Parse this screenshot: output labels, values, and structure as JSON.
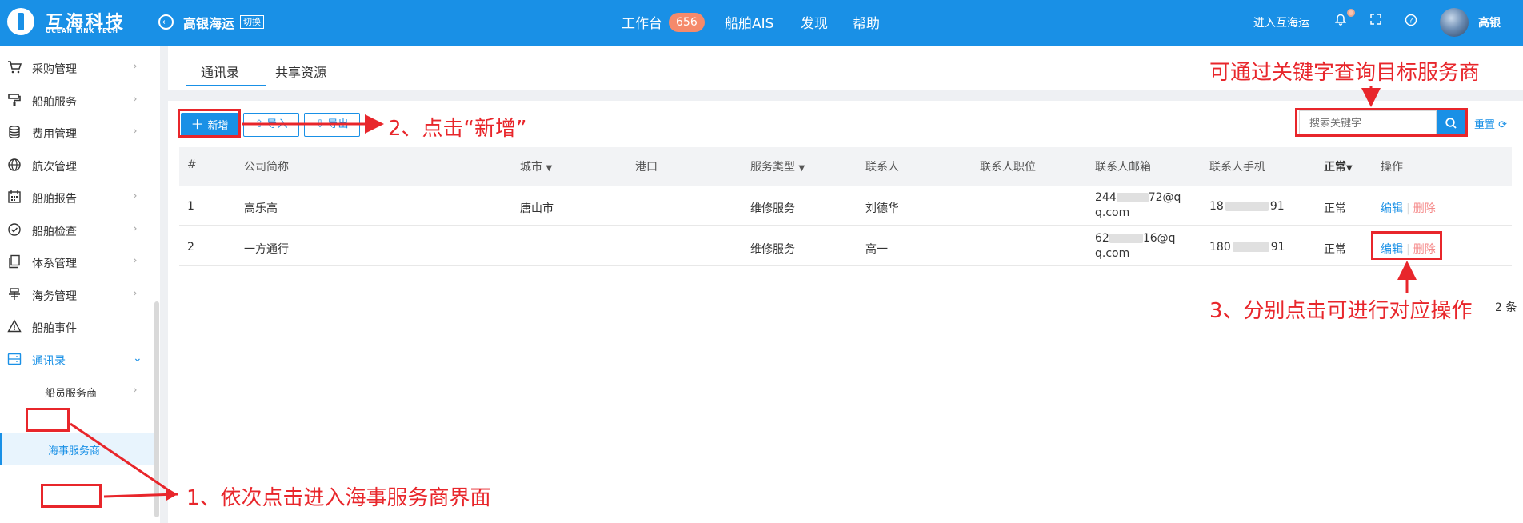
{
  "topbar": {
    "logo_cn": "互海科技",
    "logo_en": "OCEAN LINK TECH",
    "company": "高银海运",
    "switch_label": "切换",
    "nav": [
      {
        "label": "工作台"
      },
      {
        "label": "船舶AIS"
      },
      {
        "label": "发现"
      },
      {
        "label": "帮助"
      }
    ],
    "badge": "656",
    "enter_label": "进入互海运",
    "user_name": "高银",
    "icons": [
      "bell-icon",
      "fullscreen-icon",
      "help-icon"
    ]
  },
  "sidebar": {
    "items": [
      {
        "label": "采购管理",
        "icon": "cart-icon"
      },
      {
        "label": "船舶服务",
        "icon": "paint-roller-icon"
      },
      {
        "label": "费用管理",
        "icon": "coins-icon"
      },
      {
        "label": "航次管理",
        "icon": "globe-icon"
      },
      {
        "label": "船舶报告",
        "icon": "calendar-icon"
      },
      {
        "label": "船舶检查",
        "icon": "check-circle-icon"
      },
      {
        "label": "体系管理",
        "icon": "documents-icon"
      },
      {
        "label": "海务管理",
        "icon": "anchor-icon"
      },
      {
        "label": "船舶事件",
        "icon": "warning-icon"
      },
      {
        "label": "通讯录",
        "icon": "contacts-icon"
      }
    ],
    "sub_items": [
      {
        "label": "船员服务商"
      },
      {
        "label": "海事服务商"
      }
    ]
  },
  "tabs": [
    {
      "label": "通讯录"
    },
    {
      "label": "共享资源"
    }
  ],
  "toolbar": {
    "add_label": "新增",
    "import_label": "导入",
    "export_label": "导出",
    "search_placeholder": "搜索关键字",
    "reset_label": "重置"
  },
  "table": {
    "columns": [
      "#",
      "公司简称",
      "城市",
      "港口",
      "服务类型",
      "联系人",
      "联系人职位",
      "联系人邮箱",
      "联系人手机",
      "正常",
      "操作"
    ],
    "rows": [
      {
        "index": "1",
        "company": "高乐高",
        "city": "唐山市",
        "port": "",
        "service": "维修服务",
        "contact": "刘德华",
        "position": "",
        "email_a": "244",
        "email_b": "72@qq.co",
        "email_c": "m",
        "phone_a": "18",
        "phone_b": "91",
        "status": "正常",
        "edit": "编辑",
        "delete": "删除"
      },
      {
        "index": "2",
        "company": "一方通行",
        "city": "",
        "port": "",
        "service": "维修服务",
        "contact": "高一",
        "position": "",
        "email_a": "62",
        "email_b": "16@qq.co",
        "email_c": "m",
        "phone_a": "180",
        "phone_b": "91",
        "status": "正常",
        "edit": "编辑",
        "delete": "删除"
      }
    ]
  },
  "pager_text": "2 条",
  "annotations": {
    "a1": "1、依次点击进入海事服务商界面",
    "a2": "2、点击“新增”",
    "a3": "3、分别点击可进行对应操作",
    "a4": "可通过关键字查询目标服务商"
  },
  "colors": {
    "primary": "#1990e6",
    "annotation": "#e8262b",
    "badge": "#f58a6b"
  }
}
